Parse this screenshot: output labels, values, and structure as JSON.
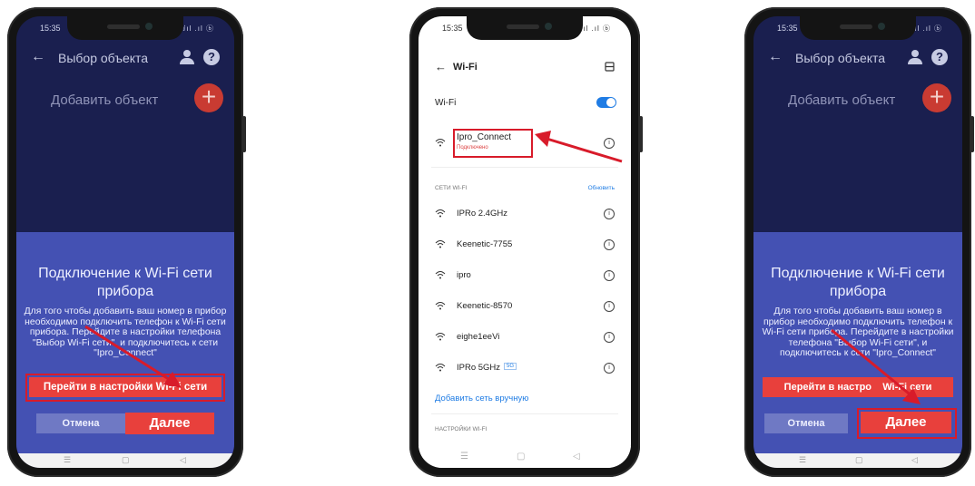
{
  "status": {
    "time": "15:35",
    "time_mid": "15:35",
    "signal": "ⅈıl .ıl ⓑ"
  },
  "app": {
    "title": "Выбор объекта",
    "add_object": "Добавить объект",
    "plus": "+",
    "sheet_title": "Подключение к Wi-Fi сети прибора",
    "sheet_body": "Для того чтобы добавить ваш номер в прибор необходимо подключить телефон к Wi-Fi сети прибора. Перейдите в настройки телефона \"Выбор Wi-Fi сети\", и подключитесь к сети \"Ipro_Connect\"",
    "settings_button": "Перейти в настройки Wi-Fi сети",
    "settings_button_right": "Перейти в настро    Wi-Fi сети",
    "cancel_button": "Отмена",
    "next_button": "Далее"
  },
  "wifi": {
    "title": "Wi-Fi",
    "toggle_label": "Wi-Fi",
    "connected_name": "Ipro_Connect",
    "connected_status": "Подключено",
    "networks_header": "СЕТИ WI-FI",
    "refresh": "Обновить",
    "networks": [
      {
        "name": "IPRo 2.4GHz"
      },
      {
        "name": "Keenetic-7755"
      },
      {
        "name": "ipro"
      },
      {
        "name": "Keenetic-8570"
      },
      {
        "name": "eighe1eeVi"
      },
      {
        "name": "IPRo 5GHz",
        "badge": "5G"
      }
    ],
    "add_manual": "Добавить сеть вручную",
    "settings_header": "НАСТРОЙКИ WI-FI"
  },
  "navbar": {
    "menu": "☰",
    "home": "▢",
    "back": "◁"
  },
  "colors": {
    "app_bg": "#1a1f4f",
    "sheet_bg": "#4451b3",
    "accent_red": "#e8403c",
    "highlight": "#d81b2a",
    "wifi_blue": "#1f7ce4"
  },
  "icons": [
    "back-arrow-icon",
    "user-icon",
    "help-icon",
    "plus-icon",
    "wifi-icon",
    "info-icon",
    "scan-icon",
    "arrow-icon"
  ]
}
